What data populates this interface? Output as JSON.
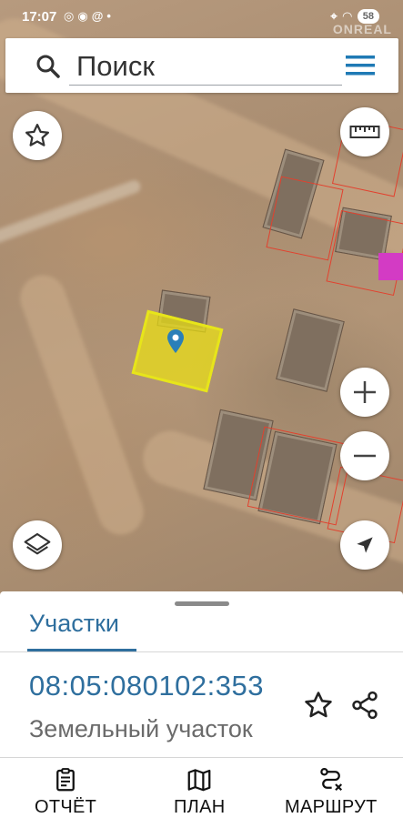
{
  "status_bar": {
    "time": "17:07",
    "left_icons": [
      "whatsapp-icon",
      "viber-icon",
      "at-icon",
      "dot-icon"
    ],
    "right_icons": [
      "location-icon",
      "wifi-icon"
    ],
    "battery": "58"
  },
  "watermark": "ONREAL",
  "search": {
    "placeholder": "Поиск"
  },
  "map": {
    "buttons": [
      "favorite-star",
      "ruler",
      "zoom-in",
      "zoom-out",
      "layers",
      "my-location"
    ],
    "selected_parcel_color": "#e7e51a",
    "boundary_color": "#e2412e",
    "highlight_color": "#d33bc4"
  },
  "sheet": {
    "tab_label": "Участки",
    "cadastral_number": "08:05:080102:353",
    "plot_type": "Земельный участок",
    "accent_color": "#2f6f9e"
  },
  "bottom_nav": {
    "report": "ОТЧЁТ",
    "plan": "ПЛАН",
    "route": "МАРШРУТ"
  }
}
